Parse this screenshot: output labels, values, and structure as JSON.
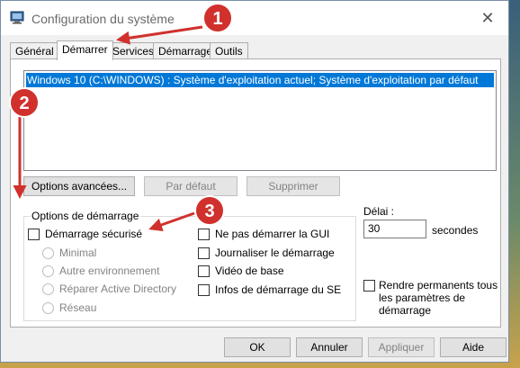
{
  "window": {
    "title": "Configuration du système",
    "close_glyph": "✕"
  },
  "tabs": [
    {
      "label": "Général"
    },
    {
      "label": "Démarrer"
    },
    {
      "label": "Services"
    },
    {
      "label": "Démarrage"
    },
    {
      "label": "Outils"
    }
  ],
  "active_tab": "Démarrer",
  "os_list": {
    "items": [
      "Windows 10 (C:\\WINDOWS) : Système d'exploitation actuel; Système d'exploitation par défaut"
    ]
  },
  "boot_buttons": {
    "advanced": "Options avancées...",
    "default": "Par défaut",
    "delete": "Supprimer"
  },
  "boot_options": {
    "group_label": "Options de démarrage",
    "safe_boot": "Démarrage sécurisé",
    "radios": [
      "Minimal",
      "Autre environnement",
      "Réparer Active Directory",
      "Réseau"
    ],
    "no_gui": "Ne pas démarrer la GUI",
    "boot_log": "Journaliser le démarrage",
    "base_video": "Vidéo de base",
    "os_boot_info": "Infos de démarrage du SE"
  },
  "timeout": {
    "label": "Délai :",
    "value": "30",
    "unit": "secondes"
  },
  "make_permanent": "Rendre permanents tous les paramètres de démarrage",
  "dialog_buttons": {
    "ok": "OK",
    "cancel": "Annuler",
    "apply": "Appliquer",
    "help": "Aide"
  },
  "annotations": [
    "1",
    "2",
    "3"
  ],
  "colors": {
    "selection": "#0078d7",
    "annotation": "#d0312d"
  }
}
